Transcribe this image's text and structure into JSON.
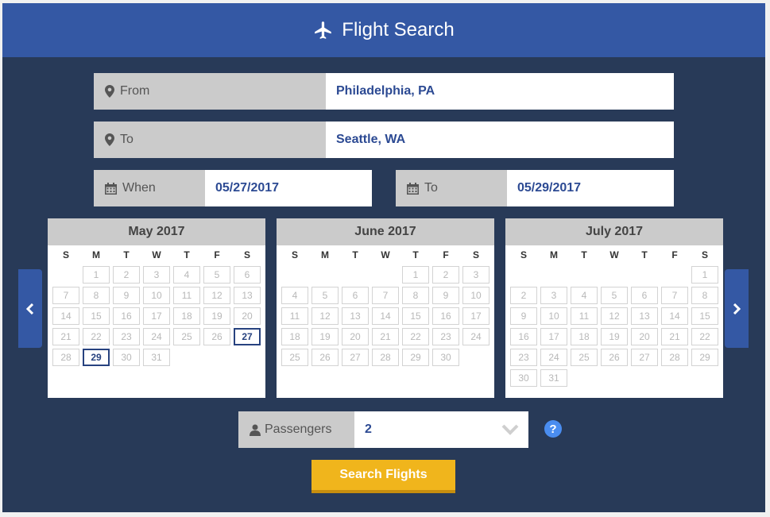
{
  "header": {
    "title": "Flight Search",
    "icon": "airplane-icon"
  },
  "from": {
    "label": "From",
    "value": "Philadelphia, PA",
    "icon": "map-marker-icon"
  },
  "to": {
    "label": "To",
    "value": "Seattle, WA",
    "icon": "map-marker-icon"
  },
  "depart": {
    "label": "When",
    "value": "05/27/2017",
    "icon": "calendar-icon"
  },
  "return": {
    "label": "To",
    "value": "05/29/2017",
    "icon": "calendar-icon"
  },
  "weekdays": [
    "S",
    "M",
    "T",
    "W",
    "T",
    "F",
    "S"
  ],
  "calendars": [
    {
      "title": "May 2017",
      "offset": 1,
      "days": 31,
      "selected": [
        27,
        29
      ]
    },
    {
      "title": "June 2017",
      "offset": 4,
      "days": 30,
      "selected": []
    },
    {
      "title": "July 2017",
      "offset": 6,
      "days": 31,
      "selected": []
    }
  ],
  "passengers": {
    "label": "Passengers",
    "value": "2",
    "icon": "user-icon"
  },
  "help": {
    "label": "?"
  },
  "search_button": {
    "label": "Search Flights"
  },
  "colors": {
    "header": "#3458a4",
    "background": "#283a58",
    "accent_text": "#2c4a93",
    "button": "#f0b51c",
    "selected_day": "#27427f"
  }
}
